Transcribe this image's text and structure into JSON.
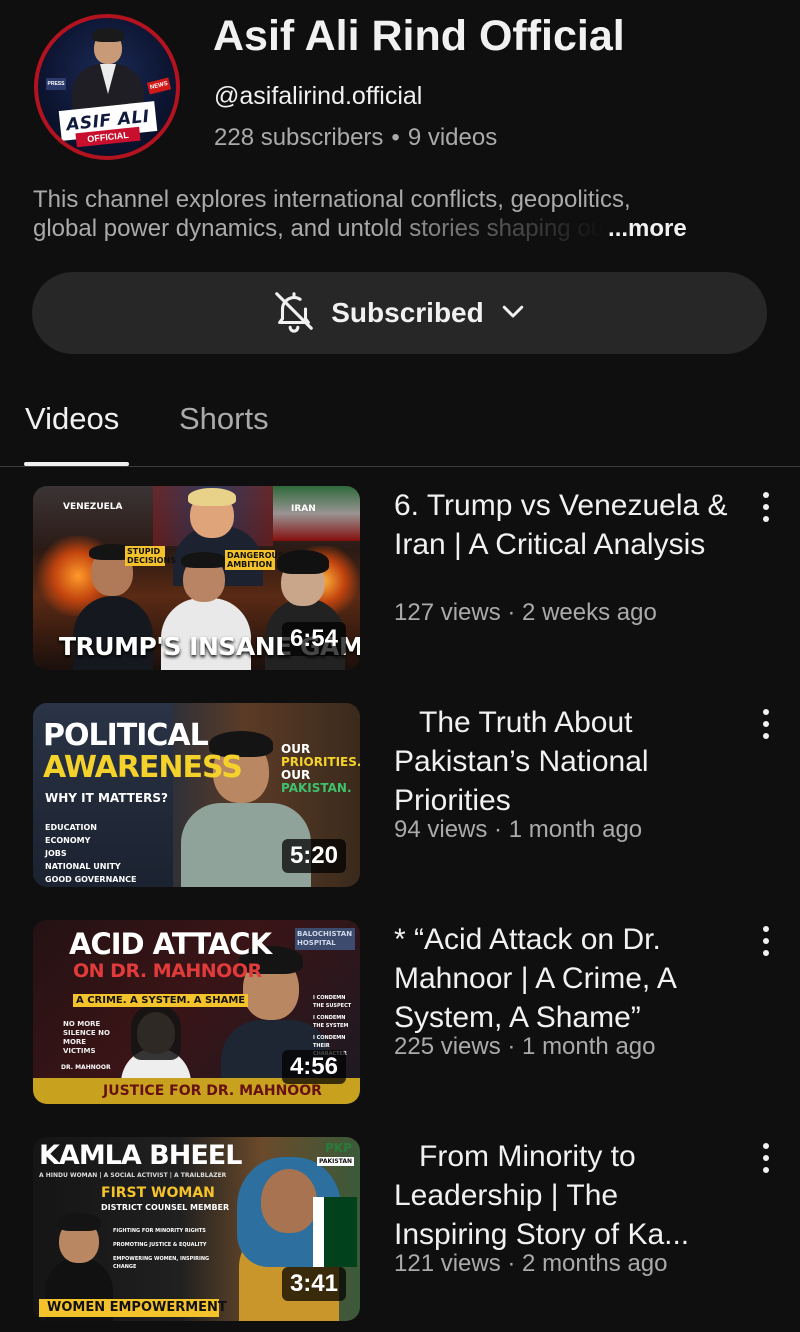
{
  "channel": {
    "name": "Asif Ali Rind Official",
    "handle": "@asifalirind.official",
    "subscribers": "228 subscribers",
    "separator": "•",
    "videos": "9 videos",
    "description_line1": "This channel explores international conflicts, geopolitics,",
    "description_line2": "global power dynamics, and untold stories shaping ou",
    "more_label": "...more",
    "avatar": {
      "banner_text": "ASIF ALI",
      "sub_text": "OFFICIAL",
      "news_tag": "NEWS",
      "press_tag": "PRESS"
    }
  },
  "subscribe": {
    "label": "Subscribed",
    "icon": "bell-off-icon"
  },
  "tabs": [
    {
      "label": "Videos",
      "active": true
    },
    {
      "label": "Shorts",
      "active": false
    }
  ],
  "videos": [
    {
      "title": "6. Trump vs Venezuela & Iran | A Critical Analysis",
      "meta": "127 views · 2 weeks ago",
      "duration": "6:54",
      "thumb": {
        "headline": "TRUMP'S INSANE GAMBLE",
        "tag_left": "VENEZUELA",
        "tag_right": "IRAN",
        "badge1": "STUPID DECISIONS",
        "badge2": "DANGEROUS AMBITION"
      }
    },
    {
      "title": "   The Truth About Pakistan’s National Priorities",
      "meta": "94 views · 1 month ago",
      "duration": "5:20",
      "thumb": {
        "headline1": "POLITICAL",
        "headline2": "AWARENESS",
        "sub": "WHY IT MATTERS?",
        "list": [
          "EDUCATION",
          "ECONOMY",
          "JOBS",
          "NATIONAL UNITY",
          "GOOD GOVERNANCE"
        ],
        "side1": "OUR",
        "side2": "PRIORITIES.",
        "side3": "OUR",
        "side4": "PAKISTAN."
      }
    },
    {
      "title": "* “Acid Attack on Dr. Mahnoor | A Crime, A System, A Shame”",
      "meta": "225 views · 1 month ago",
      "duration": "4:56",
      "thumb": {
        "headline1": "ACID ATTACK",
        "headline2": "ON DR. MAHNOOR",
        "sub": "A CRIME. A SYSTEM. A SHAME",
        "footer": "JUSTICE FOR DR. MAHNOOR",
        "sign": "BALOCHISTAN HOSPITAL",
        "note": "NO MORE SILENCE NO MORE VICTIMS",
        "points": [
          "I CONDEMN THE SUSPECT",
          "I CONDEMN THE SYSTEM",
          "I CONDEMN THEIR CHARACTER"
        ],
        "caption": "DR. MAHNOOR"
      }
    },
    {
      "title": "   From Minority to Leadership | The Inspiring Story of Ka...",
      "meta": "121 views · 2 months ago",
      "duration": "3:41",
      "thumb": {
        "headline": "KAMLA BHEEL",
        "sub": "A HINDU WOMAN | A SOCIAL ACTIVIST | A TRAILBLAZER",
        "first": "FIRST WOMAN",
        "member": "DISTRICT COUNSEL MEMBER",
        "points": [
          "FIGHTING FOR MINORITY RIGHTS",
          "PROMOTING JUSTICE & EQUALITY",
          "EMPOWERING WOMEN, INSPIRING CHANGE"
        ],
        "footer": "WOMEN EMPOWERMENT",
        "logo": "PAKISTAN",
        "logo_mark": "PKP"
      }
    }
  ],
  "colors": {
    "background": "#0f0f0f",
    "primary_text": "#f1f1f1",
    "secondary_text": "#aaaaaa",
    "button_bg": "#272727",
    "avatar_ring": "#b3121f"
  }
}
